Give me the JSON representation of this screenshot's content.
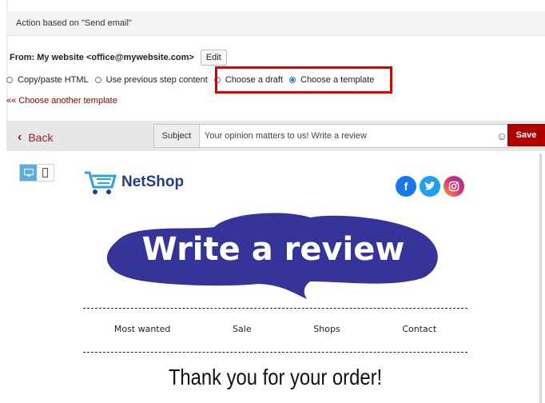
{
  "header": {
    "title": "Action based on \"Send email\""
  },
  "sender": {
    "from_label": "From: My website <office@mywebsite.com>",
    "edit_label": "Edit"
  },
  "content_options": [
    {
      "label": "Copy/paste HTML",
      "selected": false
    },
    {
      "label": "Use previous step content",
      "selected": false
    },
    {
      "label": "Choose a draft",
      "selected": false
    },
    {
      "label": "Choose a template",
      "selected": true
    }
  ],
  "choose_another": "«« Choose another template",
  "toolbar": {
    "back_label": "Back",
    "subject_label": "Subject",
    "subject_value": "Your opinion matters to us! Write a review",
    "save_label": "Save"
  },
  "email": {
    "logo_text": "NetShop",
    "banner_text": "Write a review",
    "nav": [
      "Most wanted",
      "Sale",
      "Shops",
      "Contact"
    ],
    "thanks": "Thank you for your order!"
  },
  "colors": {
    "accent": "#b00000",
    "highlight": "#e00000",
    "banner": "#34349a",
    "logo": "#1f3e8a"
  }
}
